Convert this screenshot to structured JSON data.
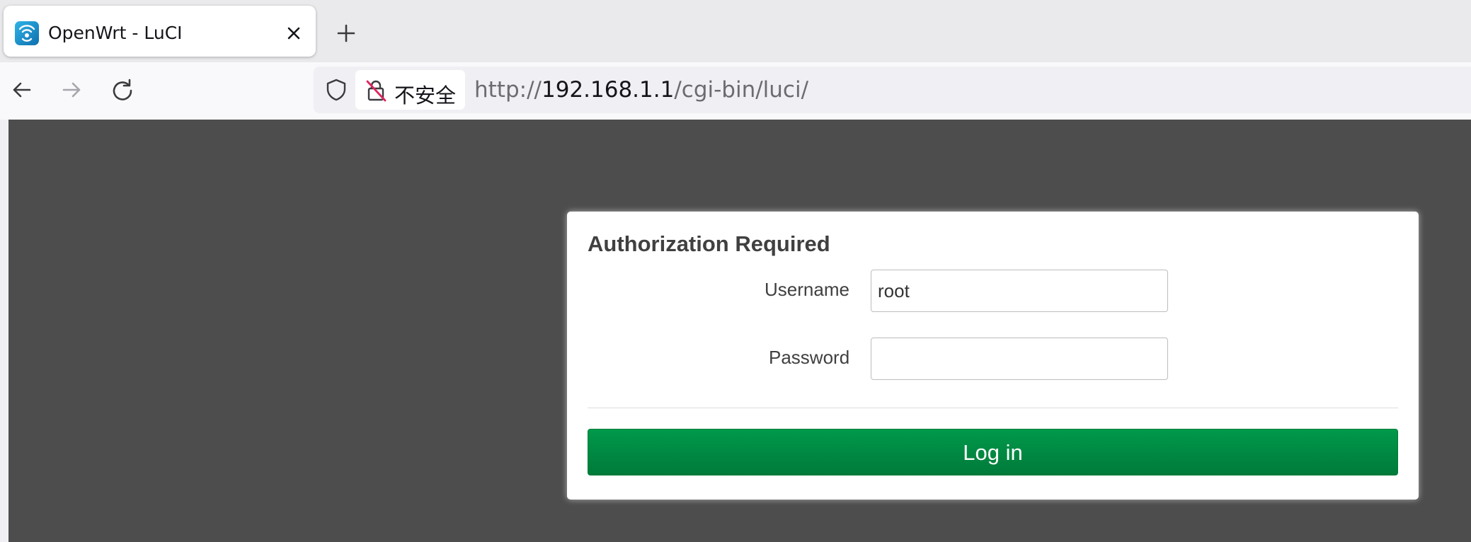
{
  "browser": {
    "tab": {
      "title": "OpenWrt - LuCI",
      "favicon": "openwrt-favicon",
      "close_icon": "close-icon"
    },
    "new_tab_icon": "plus-icon",
    "nav": {
      "back_icon": "arrow-left-icon",
      "forward_icon": "arrow-right-icon",
      "reload_icon": "reload-icon"
    },
    "urlbar": {
      "shield_icon": "shield-icon",
      "security_icon": "insecure-lock-icon",
      "security_label": "不安全",
      "url_scheme": "http://",
      "url_host": "192.168.1.1",
      "url_path": "/cgi-bin/luci/"
    }
  },
  "login": {
    "title": "Authorization Required",
    "username_label": "Username",
    "username_value": "root",
    "password_label": "Password",
    "password_value": "",
    "submit_label": "Log in"
  },
  "colors": {
    "page_background": "#4d4d4d",
    "button_green": "#008c42",
    "insecure_accent": "#e0245e"
  }
}
